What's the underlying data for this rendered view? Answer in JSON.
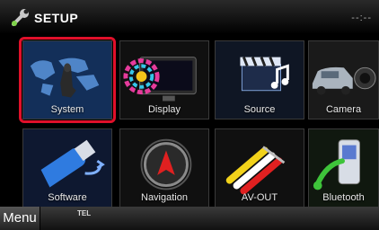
{
  "header": {
    "title": "SETUP",
    "clock": "--:--"
  },
  "tiles": [
    {
      "label": "System",
      "icon": "world-map-hand-icon"
    },
    {
      "label": "Display",
      "icon": "monitor-icon"
    },
    {
      "label": "Source",
      "icon": "clapper-music-icon"
    },
    {
      "label": "Camera",
      "icon": "car-camera-icon"
    },
    {
      "label": "Software",
      "icon": "usb-stick-icon"
    },
    {
      "label": "Navigation",
      "icon": "navigation-icon"
    },
    {
      "label": "AV-OUT",
      "icon": "rca-cables-icon"
    },
    {
      "label": "Bluetooth",
      "icon": "phone-icon"
    }
  ],
  "footer": {
    "menu_label": "Menu",
    "tel_label": "TEL"
  },
  "selected_tile": "System",
  "colors": {
    "highlight": "#e0102a",
    "background": "#000000"
  }
}
